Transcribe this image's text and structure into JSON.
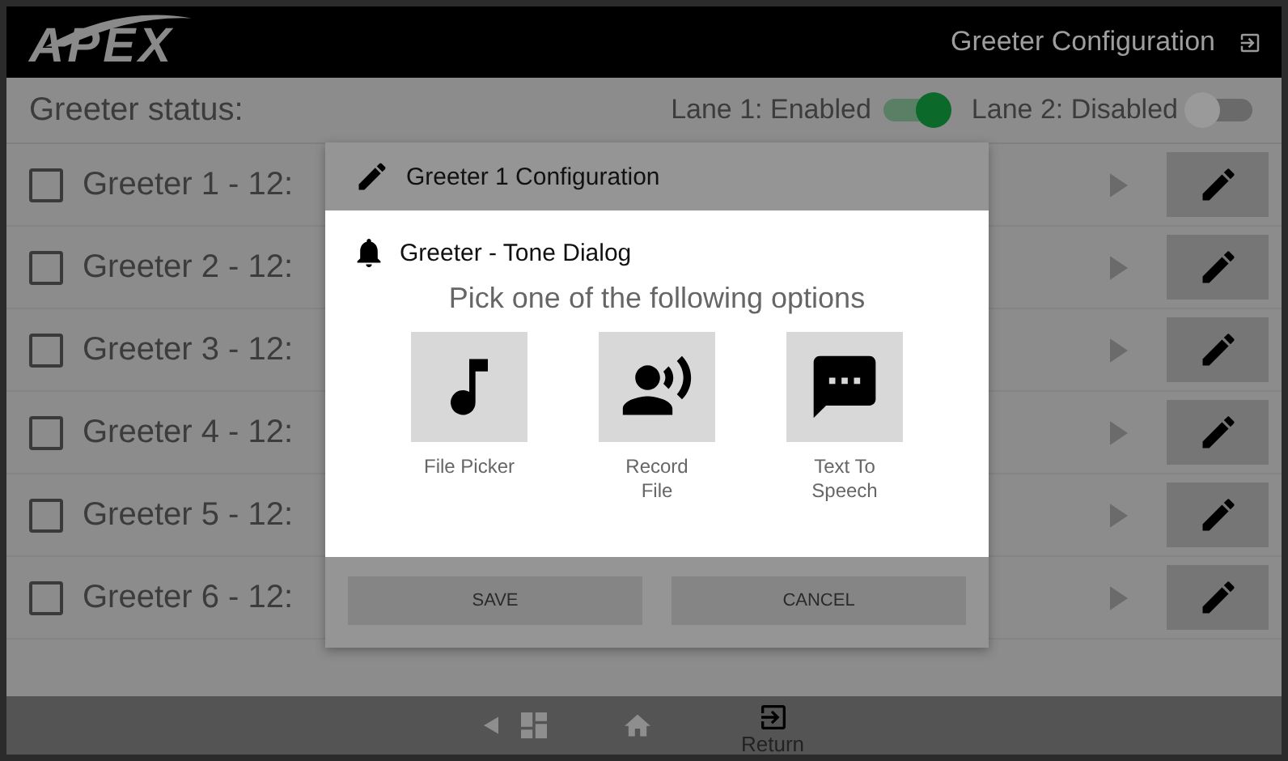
{
  "header": {
    "logo": "APEX",
    "title": "Greeter Configuration"
  },
  "status": {
    "label": "Greeter status:",
    "lanes": [
      {
        "label": "Lane 1: Enabled",
        "on": true
      },
      {
        "label": "Lane 2: Disabled",
        "on": false
      }
    ]
  },
  "greeters": [
    {
      "name": "Greeter 1 - 12:",
      "checked": false
    },
    {
      "name": "Greeter 2 - 12:",
      "checked": false
    },
    {
      "name": "Greeter 3 - 12:",
      "checked": false
    },
    {
      "name": "Greeter 4 - 12:",
      "checked": false
    },
    {
      "name": "Greeter 5 - 12:",
      "checked": false
    },
    {
      "name": "Greeter 6 - 12:",
      "checked": false
    }
  ],
  "config_dialog": {
    "title": "Greeter 1 Configuration",
    "buttons": [
      "SAVE",
      "CANCEL"
    ]
  },
  "tone_dialog": {
    "title": "Greeter - Tone Dialog",
    "prompt": "Pick one of the following options",
    "options": [
      {
        "kind": "music",
        "label": "File Picker"
      },
      {
        "kind": "record",
        "label": "Record\nFile"
      },
      {
        "kind": "speech",
        "label": "Text To\nSpeech"
      }
    ]
  },
  "nav_bar": {
    "return_label": "Return"
  }
}
